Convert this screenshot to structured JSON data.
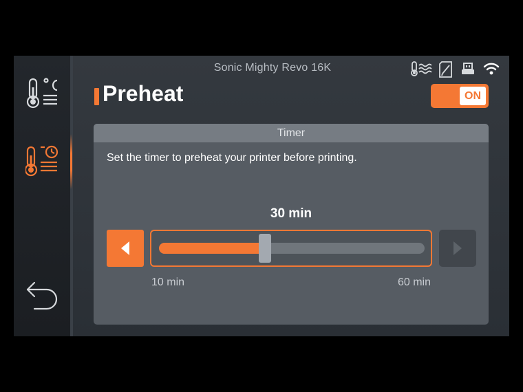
{
  "device": {
    "title": "Sonic Mighty Revo 16K"
  },
  "status_icons": [
    "thermometer-heat-icon",
    "edit-sd-icon",
    "usb-icon",
    "wifi-icon"
  ],
  "sidebar": {
    "items": [
      {
        "name": "temperature",
        "icon": "thermometer-celsius-icon",
        "active": false
      },
      {
        "name": "preheat",
        "icon": "thermometer-clock-icon",
        "active": true
      }
    ],
    "back_icon": "back-arrow-icon"
  },
  "page": {
    "title": "Preheat",
    "toggle": {
      "label": "ON",
      "state": true
    }
  },
  "timer": {
    "header": "Timer",
    "description": "Set the timer to preheat your printer before printing.",
    "value_label": "30 min",
    "value": 30,
    "min": 10,
    "max": 60,
    "min_label": "10 min",
    "max_label": "60 min"
  },
  "colors": {
    "accent": "#f47834",
    "background": "#2f343a",
    "panel": "#565c63",
    "panel_header": "#767c83"
  }
}
